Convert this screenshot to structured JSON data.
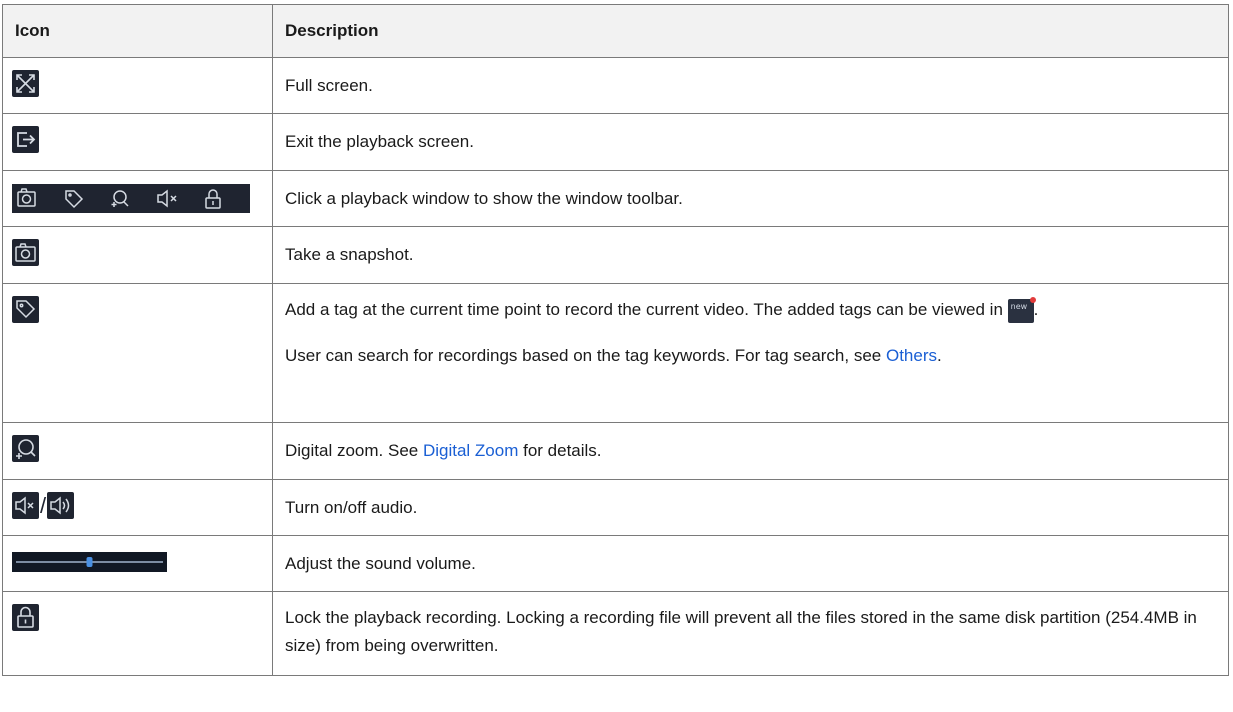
{
  "headers": {
    "icon": "Icon",
    "description": "Description"
  },
  "rows": [
    {
      "icon": "fullscreen-icon",
      "text": "Full screen."
    },
    {
      "icon": "exit-icon",
      "text": "Exit the playback screen."
    },
    {
      "icon": "window-toolbar",
      "text": "Click a playback window to show the window toolbar."
    },
    {
      "icon": "camera-icon",
      "text": "Take a snapshot."
    },
    {
      "icon": "tag-icon",
      "text_a": "Add a tag at the current time point to record the current video. The added tags can be viewed in ",
      "inline_icon": "new-tag-icon",
      "inline_icon_text": "new",
      "text_b": ".",
      "text_c": "User can search for recordings based on the tag keywords. For tag search, see ",
      "link": "Others",
      "text_d": "."
    },
    {
      "icon": "zoom-icon",
      "text_a": "Digital zoom. See ",
      "link": "Digital Zoom",
      "text_b": " for details."
    },
    {
      "icon": "audio-icons",
      "separator": "/",
      "text": "Turn on/off audio."
    },
    {
      "icon": "volume-slider",
      "volume_level": 0.5,
      "text": "Adjust the sound volume."
    },
    {
      "icon": "lock-icon",
      "text": "Lock the playback recording. Locking a recording file will prevent all the files stored in the same disk partition (254.4MB in size) from being overwritten."
    }
  ],
  "colors": {
    "icon_bg": "#1f2430",
    "link": "#1a5fd4",
    "header_bg": "#f2f2f2",
    "border": "#7a7a7a",
    "slider_thumb": "#4a90e2"
  }
}
